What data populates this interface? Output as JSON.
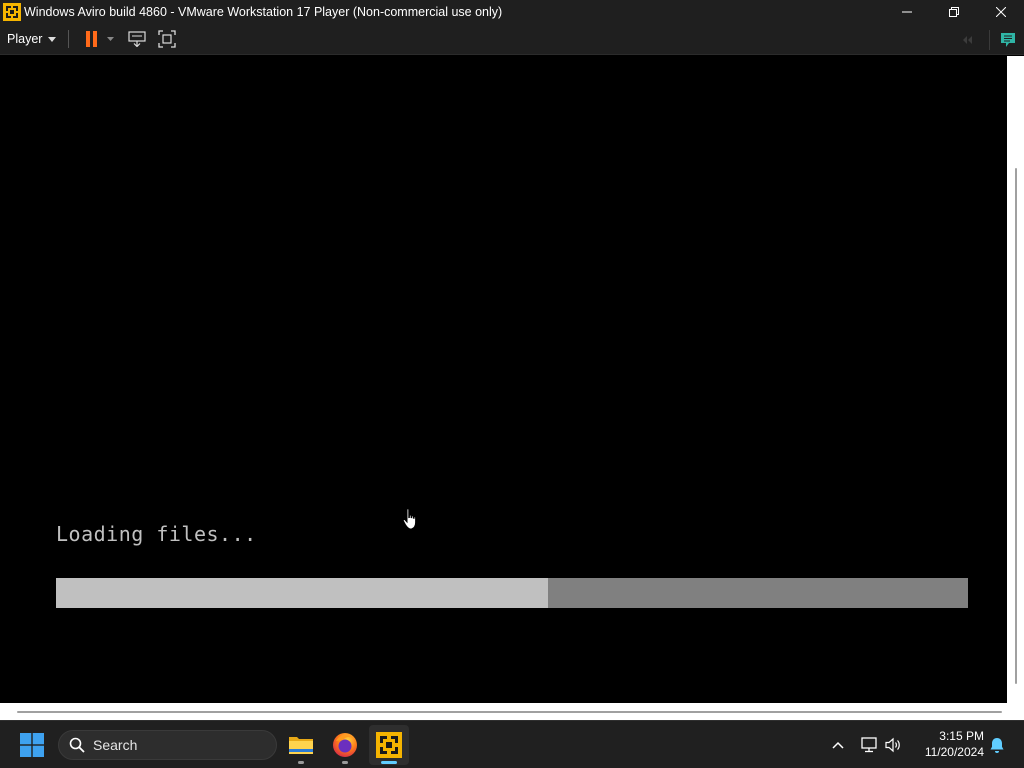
{
  "window": {
    "title": "Windows Aviro build 4860 - VMware Workstation 17 Player (Non-commercial use only)",
    "icon": "vmware-icon",
    "controls": [
      "minimize-icon",
      "restore-icon",
      "close-icon"
    ]
  },
  "toolbar": {
    "player_menu_label": "Player",
    "buttons": [
      "pause-icon",
      "dropdown-caret-icon",
      "send-ctrl-alt-del-icon",
      "fullscreen-icon",
      "unity-icon",
      "message-log-icon"
    ]
  },
  "vm_screen": {
    "status_text": "Loading files...",
    "progress_fraction": 0.54,
    "colors": {
      "background": "#000000",
      "text": "#c0c0c0",
      "progress_fill": "#c0c0c0",
      "progress_track": "#808080"
    }
  },
  "taskbar": {
    "search_label": "Search",
    "pinned_apps": [
      "file-explorer-icon",
      "firefox-icon",
      "vmware-icon"
    ],
    "tray": [
      "show-hidden-icons-icon",
      "network-icon",
      "volume-icon",
      "notification-bell-icon"
    ],
    "time": "3:15 PM",
    "date": "11/20/2024",
    "accent_color": "#60cdff"
  }
}
